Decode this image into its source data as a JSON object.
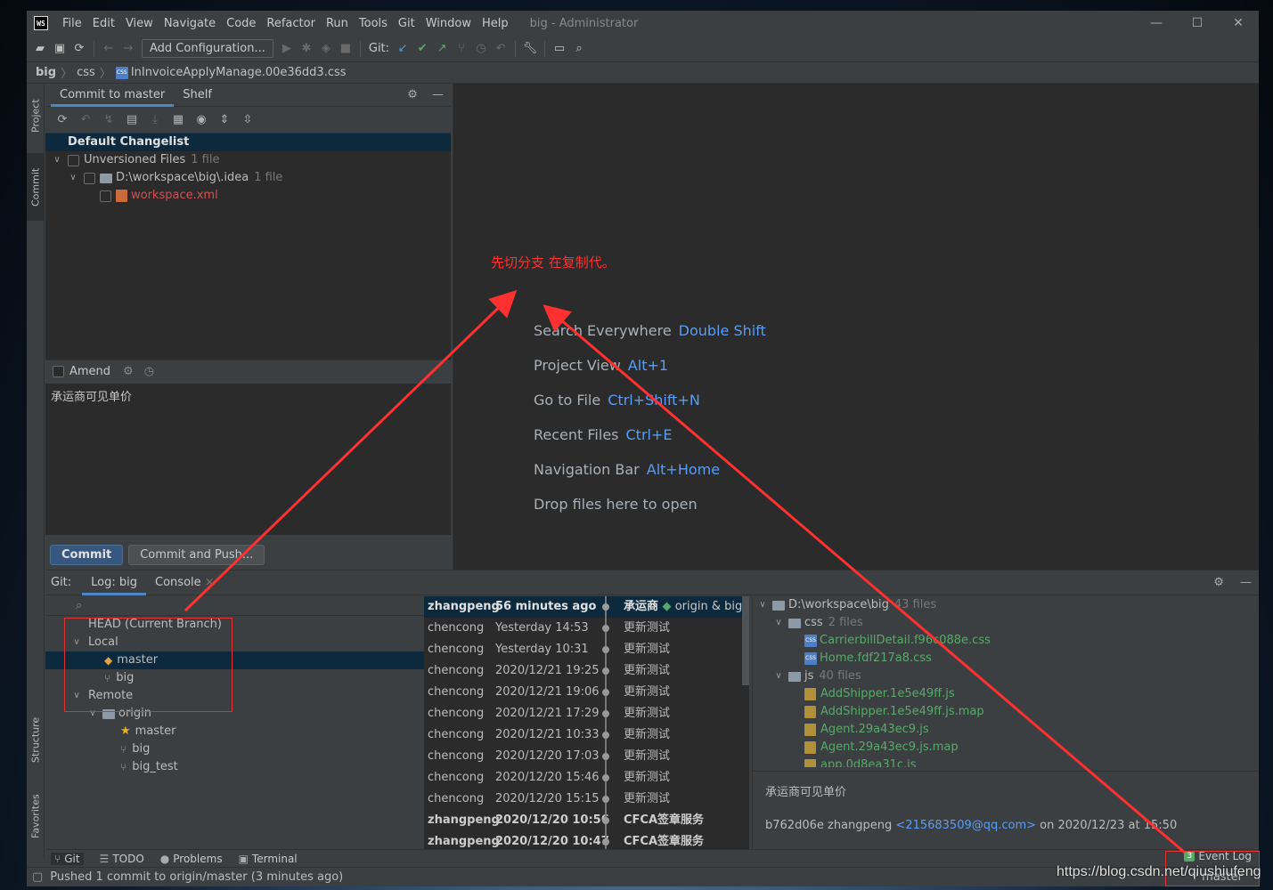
{
  "titlebar": {
    "app_icon_text": "WS",
    "menu": [
      "File",
      "Edit",
      "View",
      "Navigate",
      "Code",
      "Refactor",
      "Run",
      "Tools",
      "Git",
      "Window",
      "Help"
    ],
    "title": "big - Administrator",
    "controls": [
      "—",
      "☐",
      "✕"
    ]
  },
  "toolbar": {
    "add_config": "Add Configuration...",
    "git_label": "Git:"
  },
  "breadcrumb": {
    "project": "big",
    "folder": "css",
    "file": "InInvoiceApplyManage.00e36dd3.css",
    "file_icon_text": "CSS"
  },
  "left_strip": {
    "project": "Project",
    "commit": "Commit",
    "structure": "Structure",
    "favorites": "Favorites"
  },
  "commit_panel": {
    "tabs": [
      "Commit to master",
      "Shelf"
    ],
    "changelist": "Default Changelist",
    "unversioned": "Unversioned Files",
    "unversioned_count": "1 file",
    "folder": "D:\\workspace\\big\\.idea",
    "folder_count": "1 file",
    "file": "workspace.xml",
    "amend": "Amend",
    "message": "承运商可见单价",
    "commit_btn": "Commit",
    "commit_push_btn": "Commit and Push..."
  },
  "editor": {
    "annotation": "先切分支 在复制代。",
    "shortcuts": [
      {
        "label": "Search Everywhere",
        "key": "Double Shift"
      },
      {
        "label": "Project View",
        "key": "Alt+1"
      },
      {
        "label": "Go to File",
        "key": "Ctrl+Shift+N"
      },
      {
        "label": "Recent Files",
        "key": "Ctrl+E"
      },
      {
        "label": "Navigation Bar",
        "key": "Alt+Home"
      },
      {
        "label": "Drop files here to open",
        "key": ""
      }
    ]
  },
  "git_panel": {
    "label": "Git:",
    "tabs": [
      "Log: big",
      "Console"
    ],
    "branches": {
      "head": "HEAD (Current Branch)",
      "local": "Local",
      "local_items": [
        "master",
        "big"
      ],
      "remote": "Remote",
      "origin": "origin",
      "remote_items": [
        "master",
        "big",
        "big_test"
      ]
    },
    "commits": [
      {
        "author": "zhangpeng",
        "date": "56 minutes ago",
        "msg": "承运商",
        "refs": "origin & big"
      },
      {
        "author": "chencong",
        "date": "Yesterday 14:53",
        "msg": "更新测试",
        "refs": ""
      },
      {
        "author": "chencong",
        "date": "Yesterday 10:31",
        "msg": "更新测试",
        "refs": ""
      },
      {
        "author": "chencong",
        "date": "2020/12/21 19:25",
        "msg": "更新测试",
        "refs": ""
      },
      {
        "author": "chencong",
        "date": "2020/12/21 19:06",
        "msg": "更新测试",
        "refs": ""
      },
      {
        "author": "chencong",
        "date": "2020/12/21 17:29",
        "msg": "更新测试",
        "refs": ""
      },
      {
        "author": "chencong",
        "date": "2020/12/21 10:33",
        "msg": "更新测试",
        "refs": ""
      },
      {
        "author": "chencong",
        "date": "2020/12/20 17:03",
        "msg": "更新测试",
        "refs": ""
      },
      {
        "author": "chencong",
        "date": "2020/12/20 15:46",
        "msg": "更新测试",
        "refs": ""
      },
      {
        "author": "chencong",
        "date": "2020/12/20 15:15",
        "msg": "更新测试",
        "refs": ""
      },
      {
        "author": "zhangpeng",
        "date": "2020/12/20 10:56",
        "msg": "CFCA签章服务",
        "refs": ""
      },
      {
        "author": "zhangpeng",
        "date": "2020/12/20 10:47",
        "msg": "CFCA签章服务",
        "refs": ""
      }
    ],
    "files_root": "D:\\workspace\\big",
    "files_root_count": "43 files",
    "css_folder": "css",
    "css_count": "2 files",
    "css_files": [
      "CarrierbillDetail.f96c088e.css",
      "Home.fdf217a8.css"
    ],
    "js_folder": "js",
    "js_count": "40 files",
    "js_files": [
      "AddShipper.1e5e49ff.js",
      "AddShipper.1e5e49ff.js.map",
      "Agent.29a43ec9.js",
      "Agent.29a43ec9.js.map",
      "app.0d8ea31c.js"
    ],
    "detail_subject": "承运商可见单价",
    "detail_hash_author": "b762d06e zhangpeng",
    "detail_email": "<215683509@qq.com>",
    "detail_date": "on 2020/12/23 at 15:50"
  },
  "tool_tabs": [
    "Git",
    "TODO",
    "Problems",
    "Terminal"
  ],
  "event_log": {
    "count": "3",
    "label": "Event Log"
  },
  "status": {
    "message": "Pushed 1 commit to origin/master (3 minutes ago)",
    "branch": "master"
  },
  "watermark": "https://blog.csdn.net/qiushiufeng"
}
